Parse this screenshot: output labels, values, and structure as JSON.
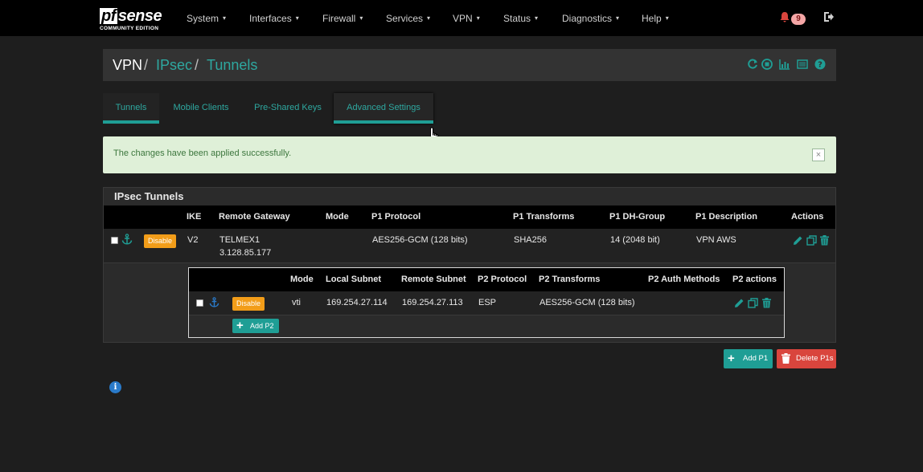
{
  "brand": {
    "logo_mark_a": "pf",
    "logo_mark_b": "sense",
    "edition": "COMMUNITY EDITION"
  },
  "nav": {
    "items": [
      {
        "label": "System"
      },
      {
        "label": "Interfaces"
      },
      {
        "label": "Firewall"
      },
      {
        "label": "Services"
      },
      {
        "label": "VPN"
      },
      {
        "label": "Status"
      },
      {
        "label": "Diagnostics"
      },
      {
        "label": "Help"
      }
    ],
    "notification_count": "9",
    "caret": "▾"
  },
  "breadcrumb": {
    "root": "VPN",
    "sep": "/",
    "level1": "IPsec",
    "level2": "Tunnels"
  },
  "tabs": [
    {
      "label": "Tunnels"
    },
    {
      "label": "Mobile Clients"
    },
    {
      "label": "Pre-Shared Keys"
    },
    {
      "label": "Advanced Settings"
    }
  ],
  "alert": {
    "message": "The changes have been applied successfully.",
    "close": "×"
  },
  "tunnels": {
    "title": "IPsec Tunnels",
    "headers": [
      "IKE",
      "Remote Gateway",
      "Mode",
      "P1 Protocol",
      "P1 Transforms",
      "P1 DH-Group",
      "P1 Description",
      "Actions"
    ],
    "p1": {
      "disable_label": "Disable",
      "ike": "V2",
      "gateway_name": "TELMEX1",
      "gateway_ip": "3.128.85.177",
      "mode": "",
      "protocol": "AES256-GCM (128 bits)",
      "transforms": "SHA256",
      "dh_group": "14 (2048 bit)",
      "description": "VPN AWS"
    },
    "p2": {
      "headers": [
        "Mode",
        "Local Subnet",
        "Remote Subnet",
        "P2 Protocol",
        "P2 Transforms",
        "P2 Auth Methods",
        "P2 actions"
      ],
      "row": {
        "disable_label": "Disable",
        "mode": "vti",
        "local_subnet": "169.254.27.114",
        "remote_subnet": "169.254.27.113",
        "protocol": "ESP",
        "transforms": "AES256-GCM (128 bits)",
        "auth_methods": ""
      },
      "add_label": "Add P2"
    }
  },
  "footer_buttons": {
    "add_p1": "Add P1",
    "delete_p1": "Delete P1s"
  },
  "colors": {
    "accent": "#1f9e95",
    "warning": "#f29d19",
    "danger": "#d9453d",
    "success_bg": "#dff0d8"
  }
}
